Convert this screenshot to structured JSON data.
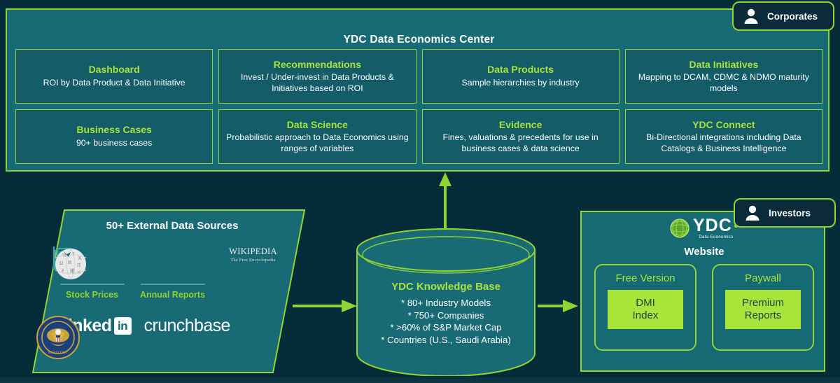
{
  "accent": {
    "green": "#8fd430",
    "bright_green": "#a9e43a",
    "panel_teal": "#186a75",
    "card_teal": "#135c68",
    "background": "#062c3a",
    "badge_navy": "#0b2a3a",
    "icon_teal": "#3fa3ad"
  },
  "top_panel": {
    "title": "YDC Data Economics Center",
    "cards": [
      {
        "title": "Dashboard",
        "subtitle": "ROI by Data Product & Data Initiative"
      },
      {
        "title": "Recommendations",
        "subtitle": "Invest / Under-invest in Data Products & Initiatives based on ROI"
      },
      {
        "title": "Data Products",
        "subtitle": "Sample hierarchies by  industry"
      },
      {
        "title": "Data Initiatives",
        "subtitle": "Mapping to DCAM, CDMC & NDMO maturity models"
      },
      {
        "title": "Business Cases",
        "subtitle": "90+ business cases"
      },
      {
        "title": "Data Science",
        "subtitle": "Probabilistic approach to Data Economics using ranges of variables"
      },
      {
        "title": "Evidence",
        "subtitle": "Fines, valuations & precedents for use in business cases & data science"
      },
      {
        "title": "YDC Connect",
        "subtitle": "Bi-Directional integrations including Data Catalogs & Business Intelligence"
      }
    ]
  },
  "personas": [
    {
      "label": "Corporates",
      "icon": "person-icon"
    },
    {
      "label": "Investors",
      "icon": "person-icon"
    }
  ],
  "sources": {
    "title": "50+ External Data Sources",
    "items": [
      {
        "label": "Stock Prices",
        "icon": "candlestick-chart-icon"
      },
      {
        "label": "Annual Reports",
        "icon": "document-report-icon"
      }
    ],
    "wikipedia": {
      "icon": "wikipedia-globe-icon",
      "wordmark": "WIKIPEDIA",
      "tagline": "The Free Encyclopedia"
    },
    "brands": [
      {
        "name": "sec-seal-icon",
        "label": "U.S. SECURITIES AND EXCHANGE COMMISSION"
      },
      {
        "name": "linkedin-logo",
        "label": "Linked",
        "mark": "in"
      },
      {
        "name": "crunchbase-logo",
        "label": "crunchbase"
      }
    ]
  },
  "knowledge_base": {
    "title": "YDC Knowledge Base",
    "bullets": [
      "* 80+ Industry Models",
      "* 750+ Companies",
      "* >60% of S&P Market Cap",
      "* Countries (U.S., Saudi Arabia)"
    ]
  },
  "website": {
    "logo": {
      "icon": "ydc-globe-icon",
      "wordmark": "YDC",
      "tagline": "Data Economics"
    },
    "heading": "Website",
    "tiers": [
      {
        "title": "Free Version",
        "chip_line1": "DMI",
        "chip_line2": "Index"
      },
      {
        "title": "Paywall",
        "chip_line1": "Premium",
        "chip_line2": "Reports"
      }
    ]
  },
  "flow": {
    "arrow_sources_to_kb": "right-arrow-icon",
    "arrow_kb_to_website": "right-arrow-icon",
    "arrow_kb_to_center": "up-arrow-icon"
  }
}
